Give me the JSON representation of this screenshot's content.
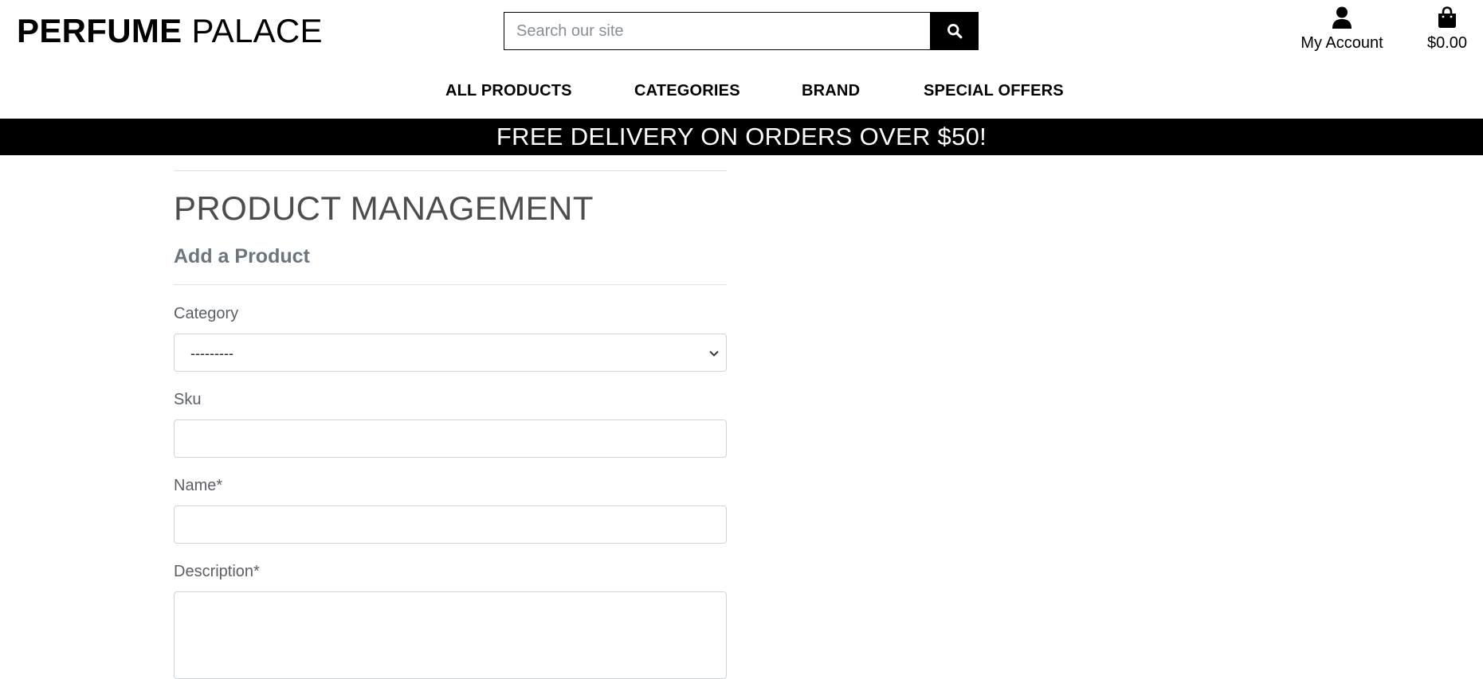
{
  "header": {
    "logo_strong": "PERFUME",
    "logo_light": "PALACE",
    "search_placeholder": "Search our site",
    "search_icon": "search-icon",
    "account_label": "My Account",
    "account_icon": "user-icon",
    "bag_total": "$0.00",
    "bag_icon": "shopping-bag-icon"
  },
  "nav": {
    "items": [
      "ALL PRODUCTS",
      "CATEGORIES",
      "BRAND",
      "SPECIAL OFFERS"
    ]
  },
  "banner": {
    "text": "FREE DELIVERY ON ORDERS OVER $50!"
  },
  "page": {
    "title": "PRODUCT MANAGEMENT",
    "subtitle": "Add a Product"
  },
  "form": {
    "category_label": "Category",
    "category_selected": "---------",
    "sku_label": "Sku",
    "sku_value": "",
    "name_label": "Name*",
    "name_value": "",
    "description_label": "Description*",
    "description_value": ""
  },
  "colors": {
    "brand_black": "#000000",
    "banner_text": "#ffffff",
    "heading_gray": "#4d4d4d",
    "subtitle_gray": "#6c757d",
    "border_gray": "#ced4da"
  }
}
